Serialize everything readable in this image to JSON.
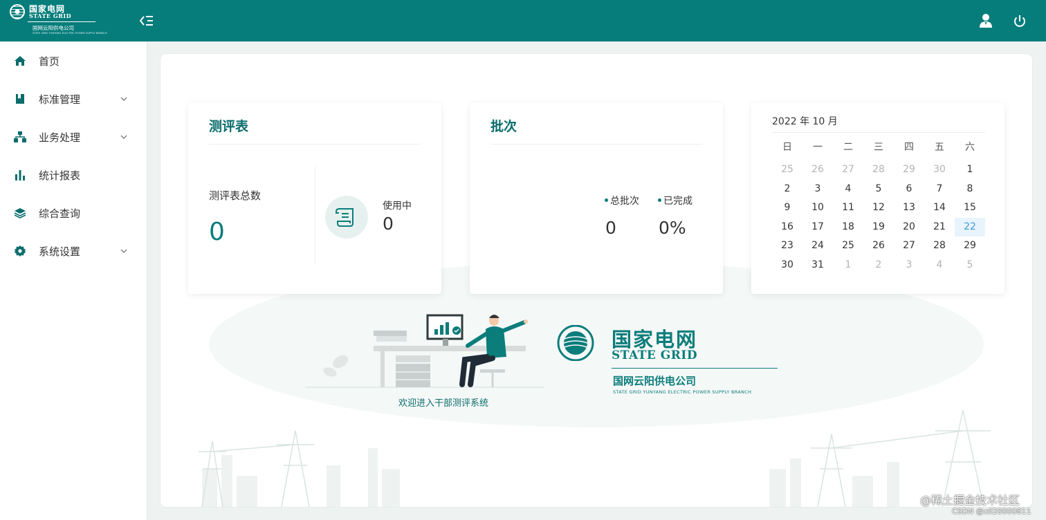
{
  "header": {
    "logo": {
      "cn": "国家电网",
      "en": "STATE GRID",
      "sub": "国网云阳供电公司",
      "tiny": "STATE GRID YUNYANG ELECTRIC POWER SUPPLY BRANCH"
    },
    "icons": {
      "collapse": "menu-collapse-icon",
      "user": "user-icon",
      "power": "power-icon"
    }
  },
  "sidebar": {
    "items": [
      {
        "label": "首页",
        "icon": "home-icon",
        "expandable": false
      },
      {
        "label": "标准管理",
        "icon": "bookmark-book-icon",
        "expandable": true
      },
      {
        "label": "业务处理",
        "icon": "org-chart-icon",
        "expandable": true
      },
      {
        "label": "统计报表",
        "icon": "bar-chart-icon",
        "expandable": false
      },
      {
        "label": "综合查询",
        "icon": "layers-icon",
        "expandable": false
      },
      {
        "label": "系统设置",
        "icon": "gear-icon",
        "expandable": true
      }
    ]
  },
  "cards": {
    "evaluation": {
      "title": "测评表",
      "total_label": "测评表总数",
      "total_value": "0",
      "in_use_label": "使用中",
      "in_use_value": "0"
    },
    "batch": {
      "title": "批次",
      "total_label": "总批次",
      "total_value": "0",
      "done_label": "已完成",
      "done_value": "0%"
    },
    "calendar": {
      "title": "2022 年 10 月",
      "weekdays": [
        "日",
        "一",
        "二",
        "三",
        "四",
        "五",
        "六"
      ],
      "today": "22",
      "days": [
        [
          "25",
          "26",
          "27",
          "28",
          "29",
          "30",
          "1"
        ],
        [
          "2",
          "3",
          "4",
          "5",
          "6",
          "7",
          "8"
        ],
        [
          "9",
          "10",
          "11",
          "12",
          "13",
          "14",
          "15"
        ],
        [
          "16",
          "17",
          "18",
          "19",
          "20",
          "21",
          "22"
        ],
        [
          "23",
          "24",
          "25",
          "26",
          "27",
          "28",
          "29"
        ],
        [
          "30",
          "31",
          "1",
          "2",
          "3",
          "4",
          "5"
        ]
      ],
      "other_month": [
        [
          true,
          true,
          true,
          true,
          true,
          true,
          false
        ],
        [
          false,
          false,
          false,
          false,
          false,
          false,
          false
        ],
        [
          false,
          false,
          false,
          false,
          false,
          false,
          false
        ],
        [
          false,
          false,
          false,
          false,
          false,
          false,
          false
        ],
        [
          false,
          false,
          false,
          false,
          false,
          false,
          false
        ],
        [
          false,
          false,
          true,
          true,
          true,
          true,
          true
        ]
      ]
    }
  },
  "welcome": {
    "text": "欢迎进入干部测评系统",
    "brand_cn": "国家电网",
    "brand_en": "STATE GRID",
    "brand_sub": "国网云阳供电公司",
    "brand_tiny": "STATE GRID YUNYANG ELECTRIC POWER SUPPLY BRANCH"
  },
  "watermark": {
    "line1": "@稀土掘金技术社区",
    "line2": "CSDN @xll20000811"
  },
  "colors": {
    "primary": "#067d7b",
    "accent_text": "#0b7d7b",
    "today_bg": "#e8f4fb",
    "today_text": "#3b9ad9"
  }
}
